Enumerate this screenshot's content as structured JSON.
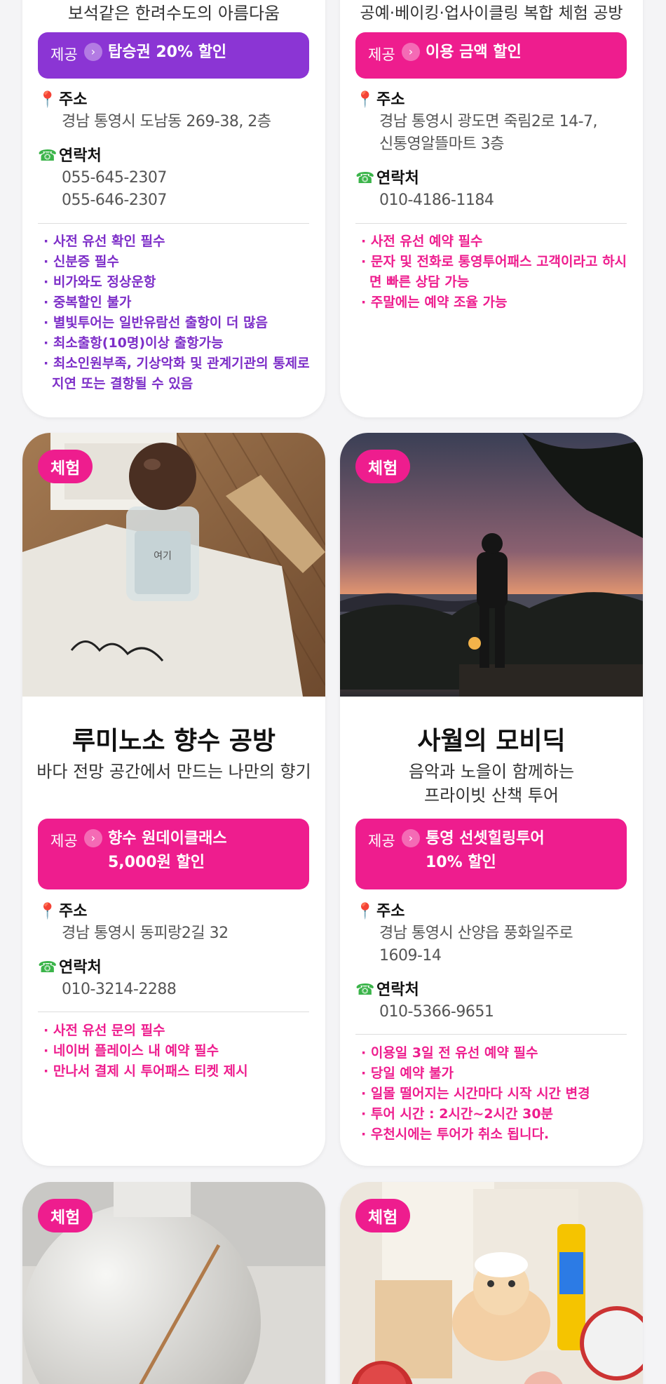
{
  "cards_top": [
    {
      "subtitle": "보석같은 한려수도의 아름다움",
      "offer_label": "제공",
      "offer_text": "탑승권 20% 할인",
      "address_label": "주소",
      "address": "경남 통영시 도남동 269-38, 2층",
      "contact_label": "연락처",
      "contacts": [
        "055-645-2307",
        "055-646-2307"
      ],
      "notes": [
        "사전 유선 확인 필수",
        "신분증 필수",
        "비가와도 정상운항",
        "중복할인 불가",
        "별빛투어는 일반유람선 출항이 더 많음",
        "최소출항(10명)이상 출항가능",
        "최소인원부족, 기상악화 및 관계기관의 통제로 지연 또는 결항될 수 있음"
      ],
      "accent": "#8b35d4"
    },
    {
      "subtitle": "공예·베이킹·업사이클링 복합 체험 공방",
      "offer_label": "제공",
      "offer_text": "이용 금액 할인",
      "address_label": "주소",
      "address": "경남 통영시 광도면 죽림2로 14-7, 신통영알뜰마트 3층",
      "contact_label": "연락처",
      "contacts": [
        "010-4186-1184"
      ],
      "notes": [
        "사전 유선 예약 필수",
        "문자 및 전화로 통영투어패스 고객이라고 하시면 빠른 상담 가능",
        "주말에는 예약 조율 가능"
      ],
      "accent": "#ee1d8e"
    }
  ],
  "cards_mid": [
    {
      "tag": "체험",
      "title": "루미노소 향수 공방",
      "subtitle": "바다 전망 공간에서 만드는 나만의 향기",
      "offer_label": "제공",
      "offer_text_1": "향수 원데이클래스",
      "offer_text_2": "5,000원 할인",
      "address_label": "주소",
      "address": "경남 통영시 동피랑2길 32",
      "contact_label": "연락처",
      "contacts": [
        "010-3214-2288"
      ],
      "notes": [
        "사전 유선 문의 필수",
        "네이버 플레이스 내 예약 필수",
        "만나서 결제 시 투어패스 티켓 제시"
      ],
      "bottle_text": "여기"
    },
    {
      "tag": "체험",
      "title": "사월의 모비딕",
      "subtitle_1": "음악과 노을이 함께하는",
      "subtitle_2": "프라이빗 산책 투어",
      "offer_label": "제공",
      "offer_text_1": "통영 선셋힐링투어",
      "offer_text_2": "10% 할인",
      "address_label": "주소",
      "address": "경남 통영시 산양읍 풍화일주로 1609-14",
      "contact_label": "연락처",
      "contacts": [
        "010-5366-9651"
      ],
      "notes": [
        "이용일 3일 전 유선 예약 필수",
        "당일 예약 불가",
        "일몰 떨어지는 시간마다 시작 시간 변경",
        "투어 시간 : 2시간~2시간 30분",
        "우천시에는 투어가 취소 됩니다."
      ]
    }
  ],
  "cards_bot": [
    {
      "tag": "체험"
    },
    {
      "tag": "체험"
    }
  ],
  "colors": {
    "pink": "#ee1d8e",
    "purple": "#8b35d4"
  }
}
